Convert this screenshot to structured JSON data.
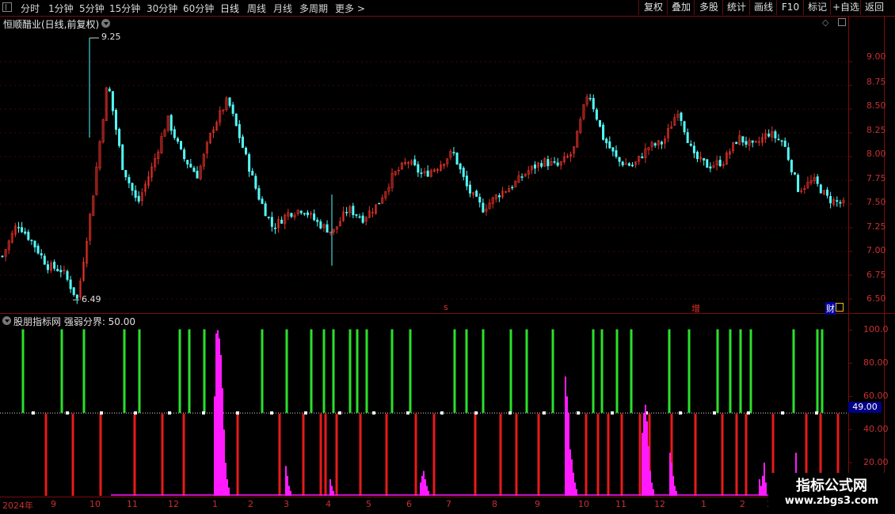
{
  "toolbar": {
    "periods": [
      "分时",
      "1分钟",
      "5分钟",
      "15分钟",
      "30分钟",
      "60分钟",
      "日线",
      "周线",
      "月线",
      "多周期",
      "更多 >"
    ],
    "active_period": "日线",
    "menu": [
      "复权",
      "叠加",
      "多股",
      "统计",
      "画线",
      "F10",
      "标记",
      "+自选",
      "返回"
    ]
  },
  "main_chart": {
    "title": "恒顺醋业(日线,前复权)",
    "high_label": "9.25",
    "low_label": "6.49",
    "y_ticks": [
      "9.00",
      "8.75",
      "8.50",
      "8.25",
      "8.00",
      "7.75",
      "7.50",
      "7.25",
      "7.00",
      "6.75",
      "6.50"
    ],
    "markers": {
      "s": "s",
      "zeng": "增",
      "cai": "财"
    }
  },
  "indicator": {
    "title": "股朋指标网 强弱分界: 50.00",
    "y_ticks": [
      "100.0",
      "80.00",
      "60.00",
      "40.00",
      "20.00"
    ],
    "current_value": "49.00"
  },
  "x_axis": {
    "labels": [
      "2024年",
      "9",
      "10",
      "11",
      "12",
      "1",
      "2",
      "3",
      "4",
      "5",
      "6",
      "7",
      "8",
      "9",
      "10",
      "11",
      "12",
      "1",
      "2",
      "3"
    ]
  },
  "watermark": {
    "title": "指标公式网",
    "url": "www.zbgs3.com"
  },
  "colors": {
    "up": "#e8322a",
    "down": "#54fcfc",
    "grid": "#7a0d0d",
    "green": "#2be02b",
    "magenta": "#ff1aff"
  },
  "chart_data": {
    "type": "candlestick",
    "title": "恒顺醋业(日线,前复权)",
    "price_range": [
      6.4,
      9.4
    ],
    "max_price": 9.25,
    "min_price": 6.49,
    "close_path_approx": [
      6.95,
      7.3,
      7.1,
      6.85,
      6.8,
      6.49,
      7.55,
      8.8,
      7.9,
      7.5,
      7.9,
      8.4,
      8.0,
      7.8,
      8.3,
      8.6,
      8.1,
      7.6,
      7.25,
      7.4,
      7.45,
      7.3,
      7.2,
      7.45,
      7.35,
      7.5,
      7.8,
      7.95,
      7.8,
      7.9,
      8.05,
      7.65,
      7.45,
      7.6,
      7.7,
      7.85,
      7.95,
      7.9,
      8.05,
      8.7,
      8.2,
      7.95,
      7.9,
      8.1,
      8.15,
      8.5,
      8.0,
      7.9,
      7.95,
      8.2,
      8.1,
      8.25,
      8.15,
      7.65,
      7.75,
      7.55,
      7.5
    ],
    "indicator_strength_line": 50.0,
    "indicator_range": [
      0,
      105
    ]
  }
}
